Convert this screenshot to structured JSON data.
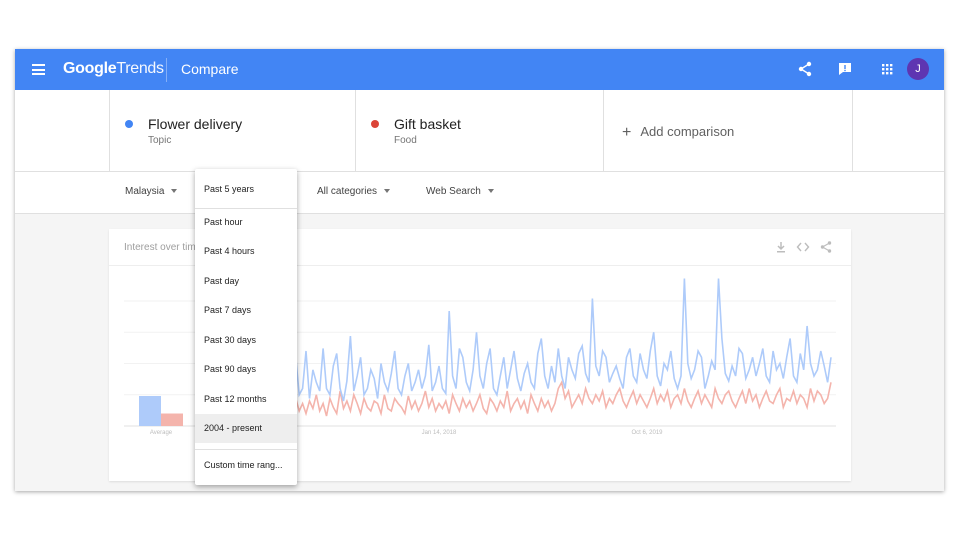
{
  "header": {
    "logo_google": "Google",
    "logo_trends": "Trends",
    "title": "Compare",
    "avatar_initial": "J",
    "icons": [
      "menu-icon",
      "share-icon",
      "feedback-icon",
      "apps-icon"
    ]
  },
  "terms": [
    {
      "name": "Flower delivery",
      "category": "Topic",
      "color": "#4285f4"
    },
    {
      "name": "Gift basket",
      "category": "Food",
      "color": "#db4437"
    }
  ],
  "add_comparison": "Add comparison",
  "filters": {
    "region": "Malaysia",
    "time": "Past 5 years",
    "category": "All categories",
    "search_type": "Web Search"
  },
  "card": {
    "title": "Interest over time",
    "icons": [
      "download-icon",
      "embed-icon",
      "share-icon"
    ]
  },
  "time_options": [
    "Past hour",
    "Past 4 hours",
    "Past day",
    "Past 7 days",
    "Past 30 days",
    "Past 90 days",
    "Past 12 months",
    "2004 - present"
  ],
  "time_selected": "2004 - present",
  "custom_time": "Custom time rang...",
  "chart_data": {
    "type": "line",
    "x_tick_labels": [
      "Average",
      "Jan 14, 2018",
      "Oct 6, 2019"
    ],
    "averages": [
      {
        "name": "Flower delivery",
        "value": 24
      },
      {
        "name": "Gift basket",
        "value": 10
      }
    ],
    "series": [
      {
        "color": "#aecbfa",
        "values": [
          40,
          20,
          55,
          25,
          30,
          60,
          22,
          45,
          35,
          28,
          62,
          30,
          25,
          48,
          58,
          30,
          20,
          36,
          72,
          28,
          40,
          55,
          25,
          30,
          45,
          38,
          22,
          50,
          35,
          28,
          42,
          60,
          30,
          25,
          40,
          50,
          28,
          35,
          45,
          30,
          40,
          65,
          28,
          35,
          48,
          30,
          26,
          92,
          40,
          30,
          62,
          55,
          35,
          28,
          45,
          75,
          40,
          30,
          50,
          62,
          30,
          25,
          40,
          55,
          30,
          45,
          60,
          38,
          28,
          42,
          50,
          35,
          30,
          58,
          70,
          40,
          30,
          48,
          35,
          62,
          40,
          30,
          55,
          45,
          38,
          58,
          64,
          42,
          35,
          102,
          48,
          40,
          60,
          55,
          35,
          42,
          48,
          38,
          30,
          55,
          62,
          40,
          35,
          58,
          45,
          38,
          60,
          75,
          40,
          32,
          50,
          45,
          60,
          38,
          30,
          40,
          118,
          50,
          38,
          45,
          60,
          55,
          30,
          40,
          52,
          45,
          118,
          70,
          42,
          36,
          48,
          40,
          62,
          58,
          38,
          45,
          55,
          40,
          50,
          62,
          40,
          35,
          60,
          45,
          50,
          38,
          55,
          70,
          40,
          35,
          58,
          45,
          80,
          50,
          40,
          45,
          60,
          48,
          35,
          55
        ]
      },
      {
        "color": "#f4b4ac",
        "values": [
          15,
          8,
          22,
          12,
          18,
          10,
          20,
          14,
          25,
          12,
          18,
          8,
          22,
          15,
          10,
          28,
          14,
          20,
          12,
          25,
          18,
          10,
          22,
          15,
          12,
          20,
          18,
          10,
          25,
          14,
          12,
          22,
          18,
          15,
          10,
          24,
          14,
          20,
          12,
          18,
          28,
          15,
          22,
          12,
          18,
          14,
          20,
          10,
          25,
          18,
          12,
          22,
          15,
          20,
          12,
          18,
          25,
          14,
          10,
          22,
          18,
          12,
          20,
          15,
          28,
          12,
          18,
          22,
          14,
          20,
          10,
          25,
          18,
          12,
          22,
          15,
          20,
          12,
          18,
          30,
          35,
          22,
          28,
          15,
          20,
          25,
          18,
          30,
          22,
          18,
          25,
          20,
          28,
          15,
          22,
          18,
          25,
          30,
          20,
          15,
          22,
          28,
          18,
          25,
          20,
          15,
          22,
          30,
          18,
          25,
          20,
          28,
          15,
          22,
          25,
          18,
          30,
          20,
          15,
          22,
          28,
          18,
          25,
          20,
          15,
          30,
          22,
          18,
          25,
          28,
          20,
          15,
          22,
          28,
          18,
          30,
          20,
          25,
          15,
          22,
          28,
          20,
          18,
          25,
          30,
          15,
          22,
          20,
          28,
          18,
          25,
          22,
          15,
          30,
          20,
          28,
          25,
          18,
          22,
          35
        ]
      }
    ]
  }
}
